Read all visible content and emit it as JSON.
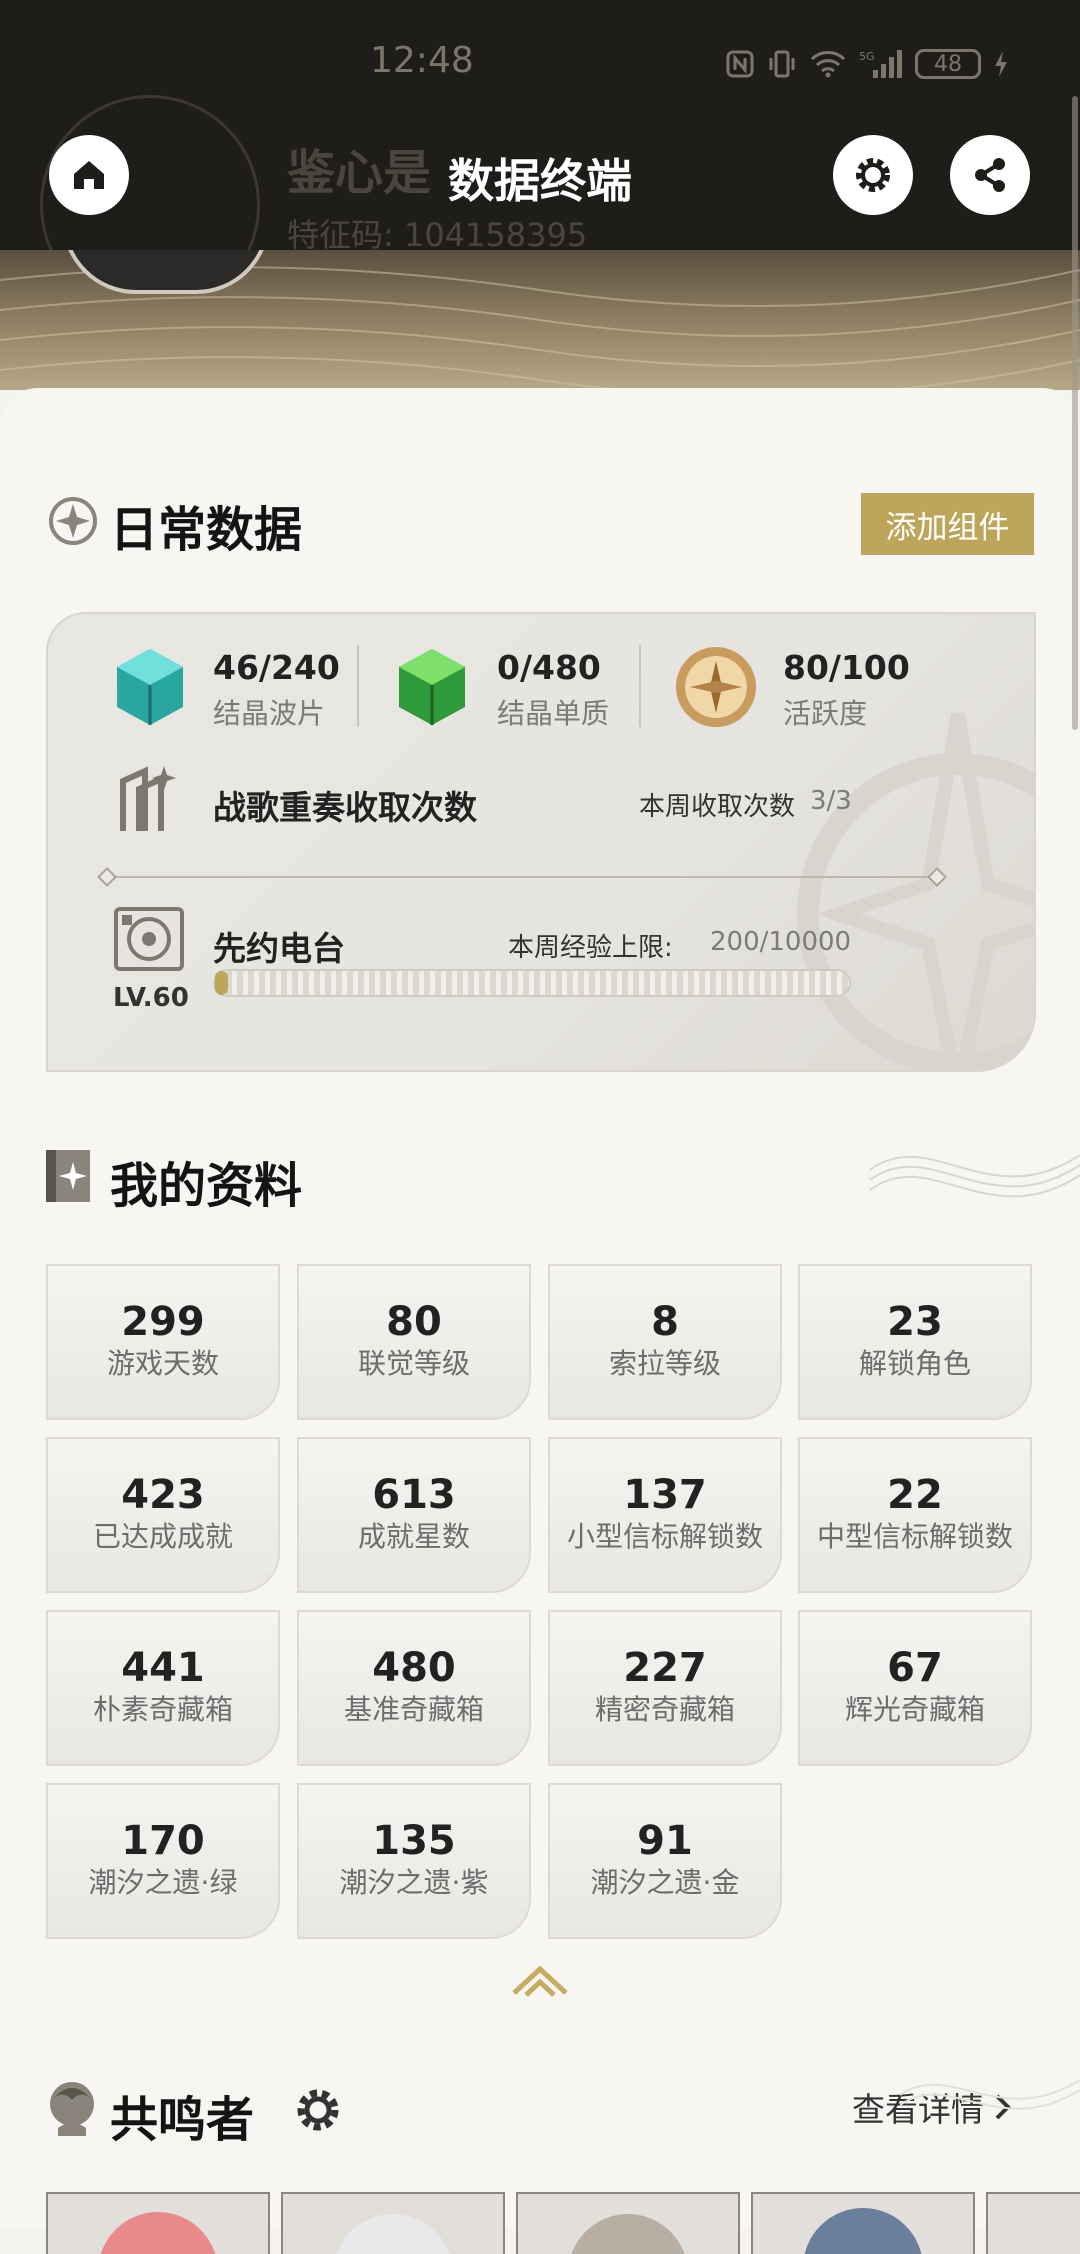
{
  "status_bar": {
    "time": "12:48",
    "battery": "48"
  },
  "header": {
    "title": "数据终端",
    "bg_name": "鉴心是",
    "bg_code": "特征码: 104158395"
  },
  "daily": {
    "title": "日常数据",
    "add_button": "添加组件",
    "stats": [
      {
        "value": "46/240",
        "label": "结晶波片"
      },
      {
        "value": "0/480",
        "label": "结晶单质"
      },
      {
        "value": "80/100",
        "label": "活跃度"
      }
    ],
    "battle_song": {
      "title": "战歌重奏收取次数",
      "weekly_label": "本周收取次数",
      "weekly_value": "3/3"
    },
    "radio": {
      "title": "先约电台",
      "level": "LV.60",
      "exp_label": "本周经验上限:",
      "exp_value": "200/10000",
      "exp_fraction": 0.02
    }
  },
  "profile": {
    "title": "我的资料",
    "tiles": [
      {
        "value": "299",
        "label": "游戏天数"
      },
      {
        "value": "80",
        "label": "联觉等级"
      },
      {
        "value": "8",
        "label": "索拉等级"
      },
      {
        "value": "23",
        "label": "解锁角色"
      },
      {
        "value": "423",
        "label": "已达成成就"
      },
      {
        "value": "613",
        "label": "成就星数"
      },
      {
        "value": "137",
        "label": "小型信标解锁数"
      },
      {
        "value": "22",
        "label": "中型信标解锁数"
      },
      {
        "value": "441",
        "label": "朴素奇藏箱"
      },
      {
        "value": "480",
        "label": "基准奇藏箱"
      },
      {
        "value": "227",
        "label": "精密奇藏箱"
      },
      {
        "value": "67",
        "label": "辉光奇藏箱"
      },
      {
        "value": "170",
        "label": "潮汐之遗·绿"
      },
      {
        "value": "135",
        "label": "潮汐之遗·紫"
      },
      {
        "value": "91",
        "label": "潮汐之遗·金"
      }
    ]
  },
  "resonators": {
    "title": "共鸣者",
    "details_link": "查看详情"
  },
  "colors": {
    "accent": "#bda55a",
    "header_bg": "#1f1d19"
  }
}
